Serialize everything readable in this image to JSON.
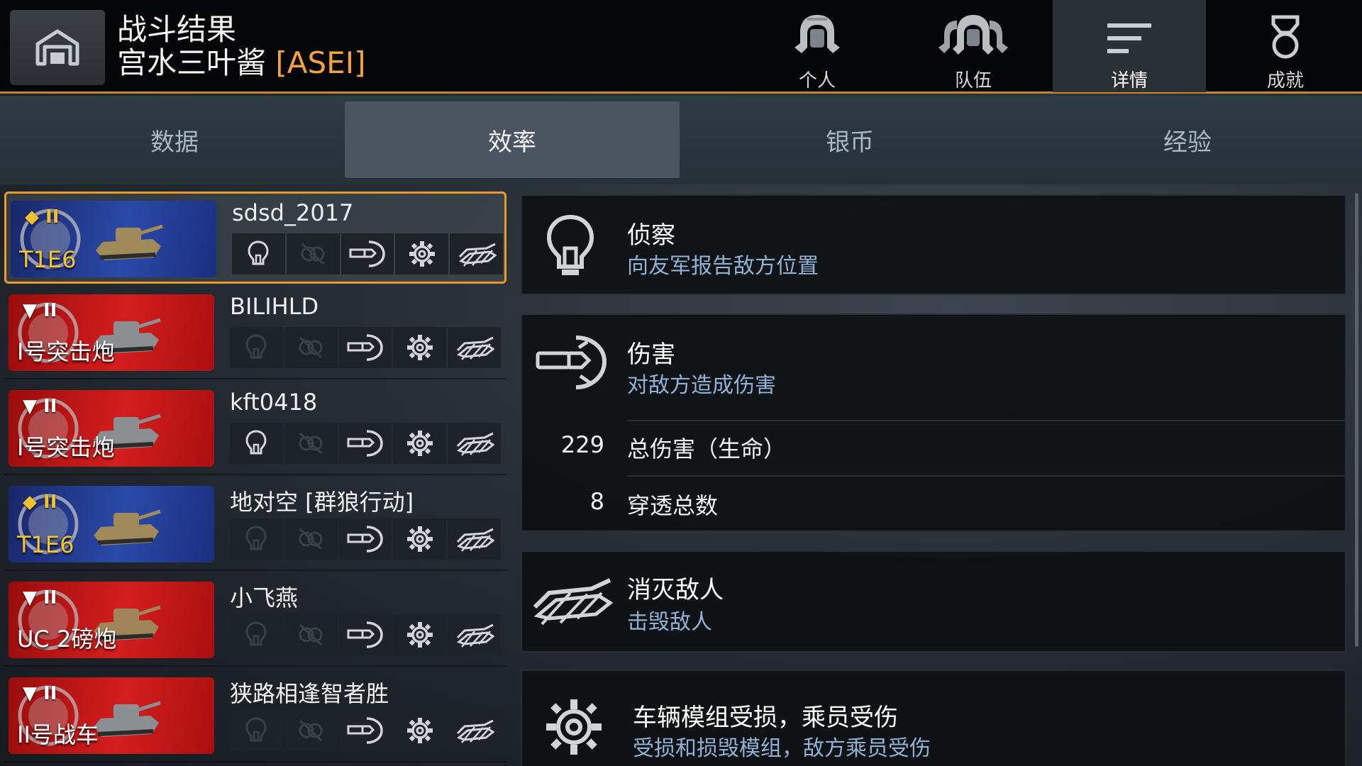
{
  "header": {
    "title": "战斗结果",
    "player_name": "宫水三叶酱",
    "clan_tag": "[ASEI]"
  },
  "top_tabs": [
    {
      "label": "个人",
      "icon": "single-helmet-icon",
      "active": false
    },
    {
      "label": "队伍",
      "icon": "team-helmets-icon",
      "active": false
    },
    {
      "label": "详情",
      "icon": "details-list-icon",
      "active": true
    },
    {
      "label": "成就",
      "icon": "medal-icon",
      "active": false
    }
  ],
  "sub_tabs": [
    {
      "label": "数据",
      "active": false
    },
    {
      "label": "效率",
      "active": true
    },
    {
      "label": "银币",
      "active": false
    },
    {
      "label": "经验",
      "active": false
    }
  ],
  "players": [
    {
      "name": "sdsd_2017",
      "tank": "T1E6",
      "nation": "usa",
      "tier": "II",
      "selected": true,
      "medals": {
        "spot": true,
        "assist": false,
        "damage": true,
        "module": true,
        "kill": true
      }
    },
    {
      "name": "BILIHLD",
      "tank": "I号突击炮",
      "nation": "germany",
      "tier": "II",
      "selected": false,
      "medals": {
        "spot": false,
        "assist": false,
        "damage": true,
        "module": true,
        "kill": true
      }
    },
    {
      "name": "kft0418",
      "tank": "I号突击炮",
      "nation": "germany",
      "tier": "II",
      "selected": false,
      "medals": {
        "spot": true,
        "assist": false,
        "damage": true,
        "module": true,
        "kill": true
      }
    },
    {
      "name": "地对空 [群狼行动]",
      "tank": "T1E6",
      "nation": "usa",
      "tier": "II",
      "selected": false,
      "medals": {
        "spot": false,
        "assist": false,
        "damage": true,
        "module": true,
        "kill": true
      }
    },
    {
      "name": "小飞燕",
      "tank": "UC 2磅炮",
      "nation": "uk",
      "tier": "II",
      "selected": false,
      "medals": {
        "spot": false,
        "assist": false,
        "damage": true,
        "module": true,
        "kill": true
      }
    },
    {
      "name": "狭路相逢智者胜",
      "tank": "II号战车",
      "nation": "germany",
      "tier": "II",
      "selected": false,
      "medals": {
        "spot": false,
        "assist": false,
        "damage": true,
        "module": true,
        "kill": true
      }
    }
  ],
  "details": {
    "spotting": {
      "title": "侦察",
      "desc": "向友军报告敌方位置",
      "icon": "lightbulb-icon"
    },
    "damage": {
      "title": "伤害",
      "desc": "对敌方造成伤害",
      "icon": "shell-impact-icon",
      "stats": [
        {
          "value": "229",
          "label": "总伤害（生命）"
        },
        {
          "value": "8",
          "label": "穿透总数"
        }
      ]
    },
    "kills": {
      "title": "消灭敌人",
      "desc": "击毁敌人",
      "icon": "destroyed-tank-icon"
    },
    "modules": {
      "title": "车辆模组受损，乘员受伤",
      "desc": "受损和损毁模组，敌方乘员受伤",
      "icon": "gear-icon"
    }
  },
  "colors": {
    "accent": "#e89a2a",
    "clan": "#f2a33a",
    "desc_blue": "#8fb2d6",
    "us_flag": "#2a4aa8",
    "de_flag": "#d41e1e"
  }
}
